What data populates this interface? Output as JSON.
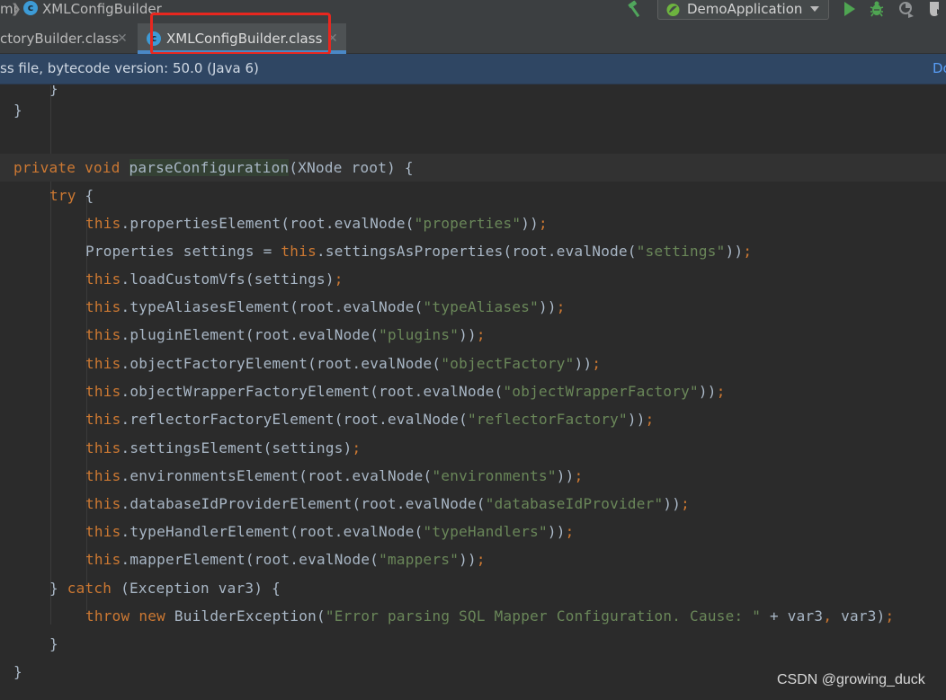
{
  "breadcrumb": {
    "prev_fragment": "ml",
    "current": "XMLConfigBuilder"
  },
  "toolbar": {
    "run_config": "DemoApplication"
  },
  "tabs": [
    {
      "label": "ctoryBuilder.class",
      "active": false
    },
    {
      "label": "XMLConfigBuilder.class",
      "active": true
    }
  ],
  "banner": {
    "message": "ss file, bytecode version: 50.0 (Java 6)",
    "link": "Do"
  },
  "colors": {
    "keyword": "#cc7832",
    "string": "#6a8759",
    "text": "#a9b7c6",
    "highlight_box": "#e8271f",
    "tab_underline": "#4a88c7"
  },
  "code": {
    "l01": "}",
    "l02": "}",
    "m_private": "private",
    "m_void": "void",
    "m_name": "parseConfiguration",
    "m_params": "(XNode root) {",
    "t_try": "try",
    "t_brace": " {",
    "this": "this",
    "s1a": ".propertiesElement(root.evalNode(",
    "s1s": "\"properties\"",
    "s1b": "))",
    "s2a": "Properties settings = ",
    "s2b": ".settingsAsProperties(root.evalNode(",
    "s2s": "\"settings\"",
    "s2c": "))",
    "s3a": ".loadCustomVfs(settings)",
    "s4a": ".typeAliasesElement(root.evalNode(",
    "s4s": "\"typeAliases\"",
    "s4b": "))",
    "s5a": ".pluginElement(root.evalNode(",
    "s5s": "\"plugins\"",
    "s5b": "))",
    "s6a": ".objectFactoryElement(root.evalNode(",
    "s6s": "\"objectFactory\"",
    "s6b": "))",
    "s7a": ".objectWrapperFactoryElement(root.evalNode(",
    "s7s": "\"objectWrapperFactory\"",
    "s7b": "))",
    "s8a": ".reflectorFactoryElement(root.evalNode(",
    "s8s": "\"reflectorFactory\"",
    "s8b": "))",
    "s9a": ".settingsElement(settings)",
    "s10a": ".environmentsElement(root.evalNode(",
    "s10s": "\"environments\"",
    "s10b": "))",
    "s11a": ".databaseIdProviderElement(root.evalNode(",
    "s11s": "\"databaseIdProvider\"",
    "s11b": "))",
    "s12a": ".typeHandlerElement(root.evalNode(",
    "s12s": "\"typeHandlers\"",
    "s12b": "))",
    "s13a": ".mapperElement(root.evalNode(",
    "s13s": "\"mappers\"",
    "s13b": "))",
    "semi": ";",
    "c_close": "} ",
    "c_catch": "catch",
    "c_rest": " (Exception var3) {",
    "th_throw": "throw",
    "th_new": "new",
    "th_a": " BuilderException(",
    "th_s": "\"Error parsing SQL Mapper Configuration. Cause: \"",
    "th_b": " + var3",
    "th_c": ", ",
    "th_d": "var3)",
    "l_end1": "}",
    "l_end2": "}"
  },
  "watermark": "CSDN @growing_duck"
}
